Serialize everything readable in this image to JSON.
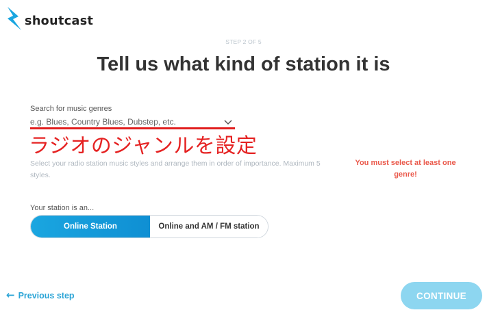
{
  "brand": {
    "name": "shoutcast",
    "icon": "lightning-bolt-icon",
    "icon_color": "#1aa6e0"
  },
  "step": {
    "label": "STEP 2 OF 5"
  },
  "page": {
    "title": "Tell us what kind of station it is"
  },
  "genres": {
    "label": "Search for music genres",
    "placeholder": "e.g. Blues, Country Blues, Dubstep, etc.",
    "value": "",
    "dropdown_icon": "chevron-down-icon",
    "hint": "Select your radio station music styles and arrange them in order of importance. Maximum 5 styles.",
    "error": "You must select at least one genre!"
  },
  "annotation": {
    "text": "ラジオのジャンルを設定",
    "color": "#e52222"
  },
  "station_type": {
    "label": "Your station is an...",
    "options": [
      {
        "label": "Online Station",
        "selected": true
      },
      {
        "label": "Online and AM / FM station",
        "selected": false
      }
    ],
    "accent": "#1aa6e0"
  },
  "nav": {
    "previous": {
      "arrow": "←",
      "label": "Previous step"
    },
    "continue": {
      "label": "CONTINUE"
    }
  }
}
